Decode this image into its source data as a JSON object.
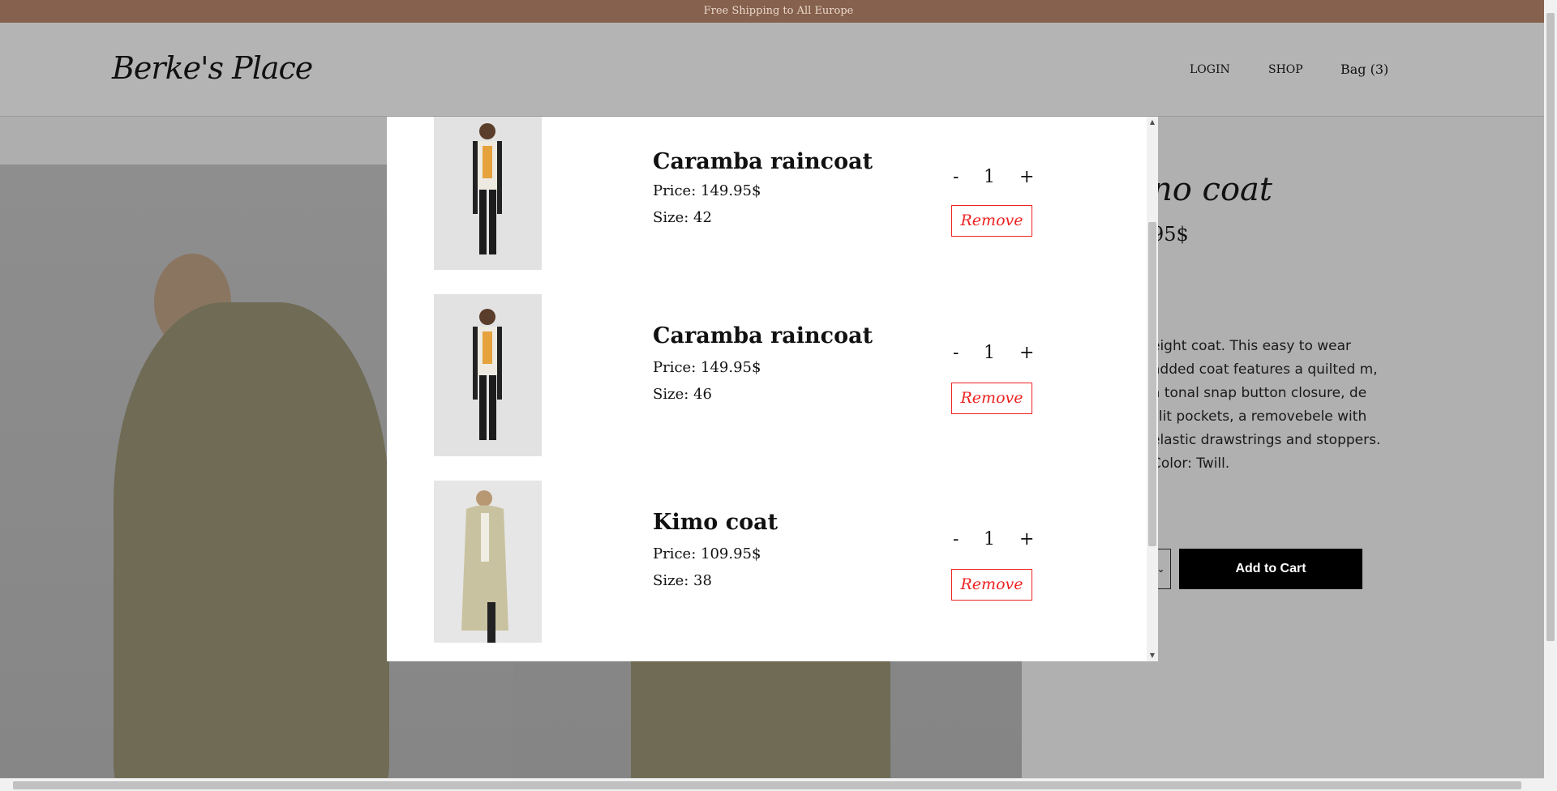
{
  "topbar": {
    "text": "Free Shipping to All Europe"
  },
  "header": {
    "logo": "Berke's Place",
    "nav": {
      "login": "LOGIN",
      "shop": "SHOP",
      "bag": "Bag (3)"
    }
  },
  "product": {
    "title": "no coat",
    "price": "95$",
    "description": "eight coat. This easy to wear added coat features a quilted m, a tonal snap button closure, de slit pockets, a removebele with elastic drawstrings and stoppers. Color: Twill.",
    "size_select_glyph": "⌄",
    "add_to_cart": "Add to Cart"
  },
  "cart": {
    "items": [
      {
        "name": "Caramba raincoat",
        "price": "Price: 149.95$",
        "size": "Size: 42",
        "minus": "-",
        "qty": "1",
        "plus": "+",
        "remove": "Remove",
        "image_icon": "model-photo-icon"
      },
      {
        "name": "Caramba raincoat",
        "price": "Price: 149.95$",
        "size": "Size: 46",
        "minus": "-",
        "qty": "1",
        "plus": "+",
        "remove": "Remove",
        "image_icon": "model-photo-icon"
      },
      {
        "name": "Kimo coat",
        "price": "Price: 109.95$",
        "size": "Size: 38",
        "minus": "-",
        "qty": "1",
        "plus": "+",
        "remove": "Remove",
        "image_icon": "model-photo-icon"
      }
    ]
  },
  "colors": {
    "topbar": "#86614d",
    "remove": "#e22222",
    "button": "#000000"
  }
}
